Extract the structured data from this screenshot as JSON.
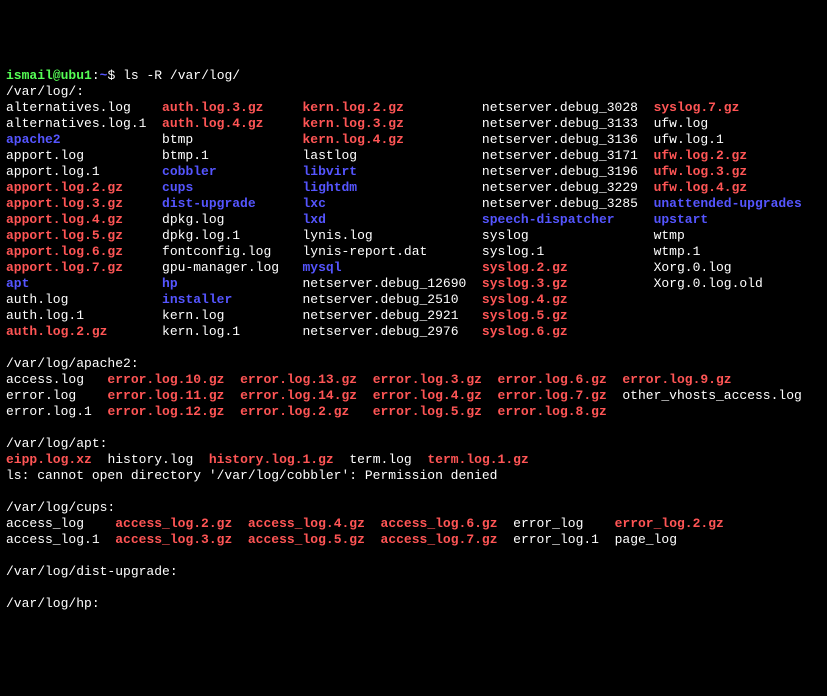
{
  "prompt": {
    "user": "ismail",
    "host": "ubu1",
    "path": "~",
    "sym": "$",
    "cmd": "ls -R /var/log/"
  },
  "dir_varlog": "/var/log/:",
  "c": {
    "r1": {
      "a": "alternatives.log",
      "b": "auth.log.3.gz",
      "c": "kern.log.2.gz",
      "d": "netserver.debug_3028",
      "e": "syslog.7.gz"
    },
    "r2": {
      "a": "alternatives.log.1",
      "b": "auth.log.4.gz",
      "c": "kern.log.3.gz",
      "d": "netserver.debug_3133",
      "e": "ufw.log"
    },
    "r3": {
      "a": "apache2",
      "b": "btmp",
      "c": "kern.log.4.gz",
      "d": "netserver.debug_3136",
      "e": "ufw.log.1"
    },
    "r4": {
      "a": "apport.log",
      "b": "btmp.1",
      "c": "lastlog",
      "d": "netserver.debug_3171",
      "e": "ufw.log.2.gz"
    },
    "r5": {
      "a": "apport.log.1",
      "b": "cobbler",
      "c": "libvirt",
      "d": "netserver.debug_3196",
      "e": "ufw.log.3.gz"
    },
    "r6": {
      "a": "apport.log.2.gz",
      "b": "cups",
      "c": "lightdm",
      "d": "netserver.debug_3229",
      "e": "ufw.log.4.gz"
    },
    "r7": {
      "a": "apport.log.3.gz",
      "b": "dist-upgrade",
      "c": "lxc",
      "d": "netserver.debug_3285",
      "e": "unattended-upgrades"
    },
    "r8": {
      "a": "apport.log.4.gz",
      "b": "dpkg.log",
      "c": "lxd",
      "d": "speech-dispatcher",
      "e": "upstart"
    },
    "r9": {
      "a": "apport.log.5.gz",
      "b": "dpkg.log.1",
      "c": "lynis.log",
      "d": "syslog",
      "e": "wtmp"
    },
    "r10": {
      "a": "apport.log.6.gz",
      "b": "fontconfig.log",
      "c": "lynis-report.dat",
      "d": "syslog.1",
      "e": "wtmp.1"
    },
    "r11": {
      "a": "apport.log.7.gz",
      "b": "gpu-manager.log",
      "c": "mysql",
      "d": "syslog.2.gz",
      "e": "Xorg.0.log"
    },
    "r12": {
      "a": "apt",
      "b": "hp",
      "c": "netserver.debug_12690",
      "d": "syslog.3.gz",
      "e": "Xorg.0.log.old"
    },
    "r13": {
      "a": "auth.log",
      "b": "installer",
      "c": "netserver.debug_2510",
      "d": "syslog.4.gz"
    },
    "r14": {
      "a": "auth.log.1",
      "b": "kern.log",
      "c": "netserver.debug_2921",
      "d": "syslog.5.gz"
    },
    "r15": {
      "a": "auth.log.2.gz",
      "b": "kern.log.1",
      "c": "netserver.debug_2976",
      "d": "syslog.6.gz"
    }
  },
  "dir_apache2": "/var/log/apache2:",
  "a": {
    "r1": {
      "a": "access.log",
      "b": "error.log.10.gz",
      "c": "error.log.13.gz",
      "d": "error.log.3.gz",
      "e": "error.log.6.gz",
      "f": "error.log.9.gz"
    },
    "r2": {
      "a": "error.log",
      "b": "error.log.11.gz",
      "c": "error.log.14.gz",
      "d": "error.log.4.gz",
      "e": "error.log.7.gz",
      "f": "other_vhosts_access.log"
    },
    "r3": {
      "a": "error.log.1",
      "b": "error.log.12.gz",
      "c": "error.log.2.gz",
      "d": "error.log.5.gz",
      "e": "error.log.8.gz"
    }
  },
  "dir_apt": "/var/log/apt:",
  "apt": {
    "a": "eipp.log.xz",
    "b": "history.log",
    "c": "history.log.1.gz",
    "d": "term.log",
    "e": "term.log.1.gz"
  },
  "err": "ls: cannot open directory '/var/log/cobbler': Permission denied",
  "dir_cups": "/var/log/cups:",
  "cu": {
    "r1": {
      "a": "access_log",
      "b": "access_log.2.gz",
      "c": "access_log.4.gz",
      "d": "access_log.6.gz",
      "e": "error_log",
      "f": "error_log.2.gz"
    },
    "r2": {
      "a": "access_log.1",
      "b": "access_log.3.gz",
      "c": "access_log.5.gz",
      "d": "access_log.7.gz",
      "e": "error_log.1",
      "f": "page_log"
    }
  },
  "dir_dist": "/var/log/dist-upgrade:",
  "dir_hp": "/var/log/hp:"
}
